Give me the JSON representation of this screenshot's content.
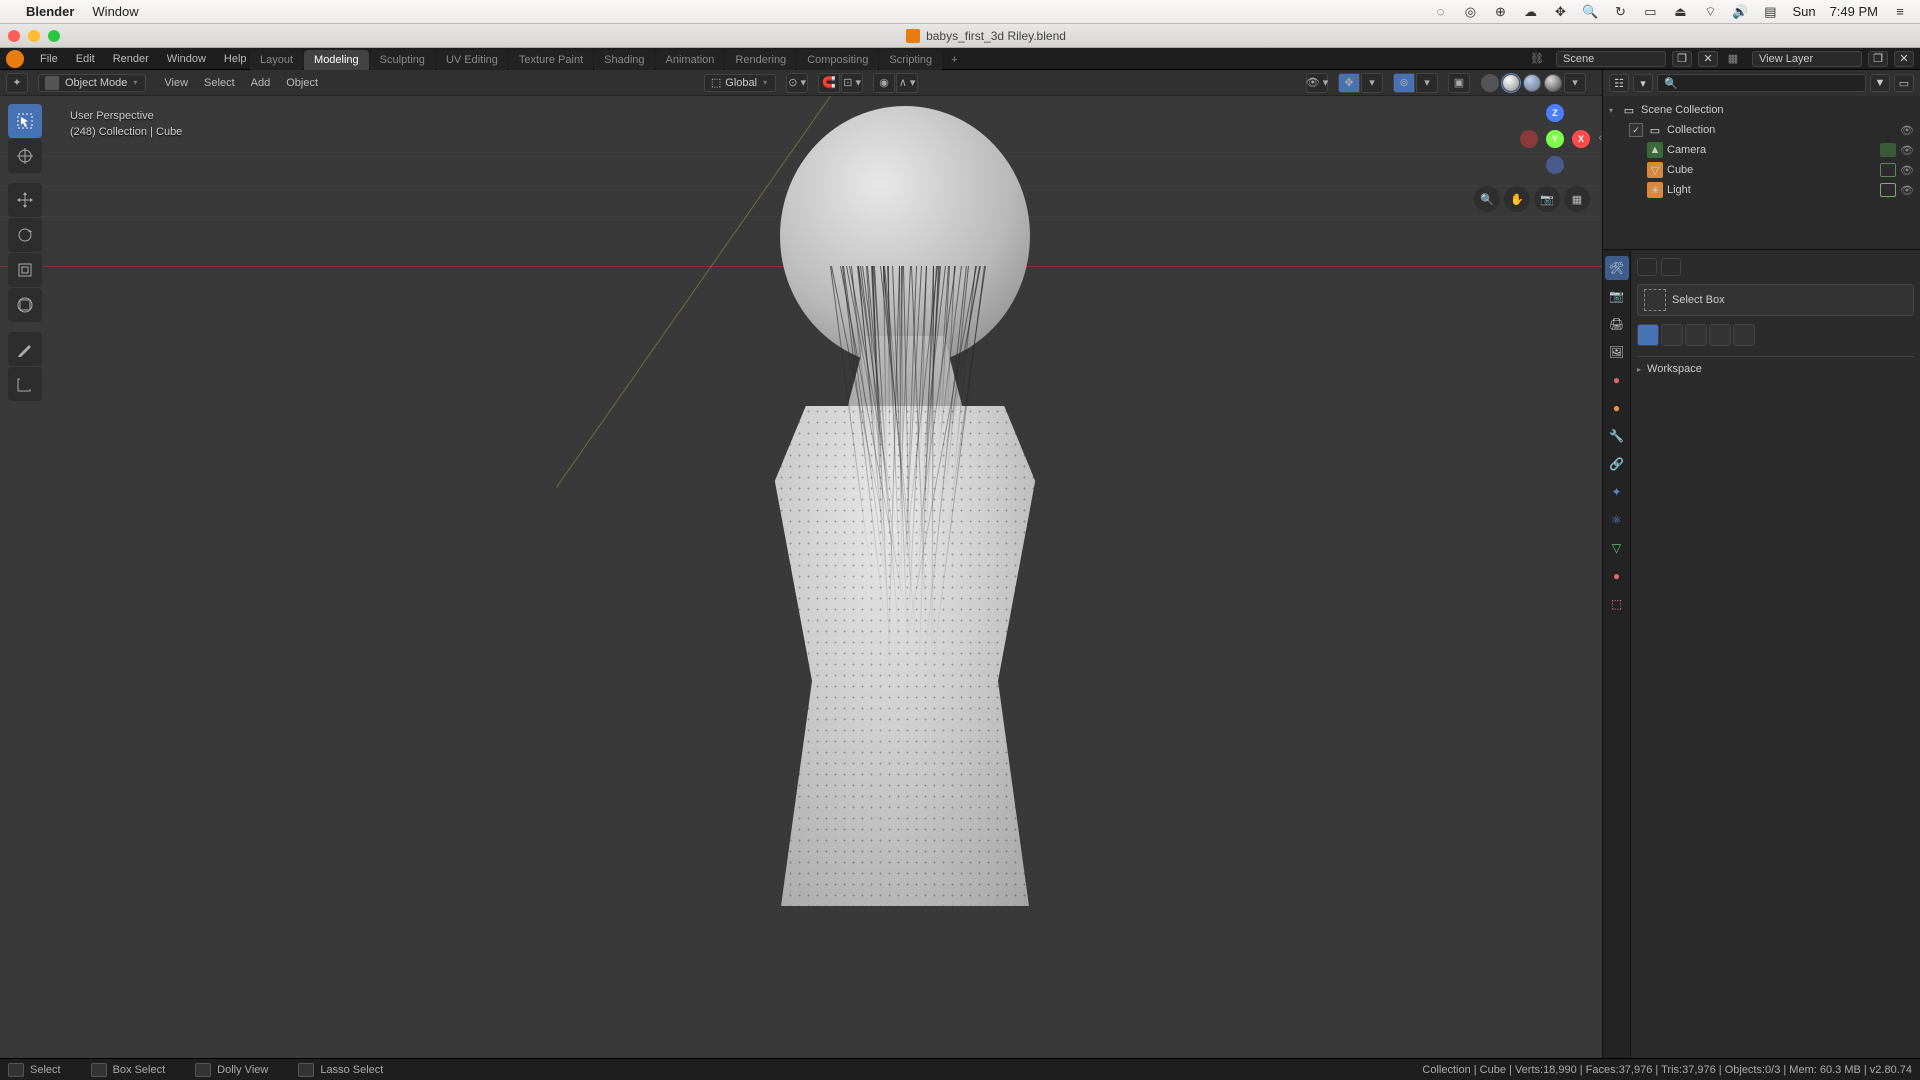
{
  "mac": {
    "app": "Blender",
    "menu2": "Window",
    "day": "Sun",
    "time": "7:49 PM"
  },
  "window": {
    "title": "babys_first_3d Riley.blend"
  },
  "topmenu": {
    "file": "File",
    "edit": "Edit",
    "render": "Render",
    "window": "Window",
    "help": "Help"
  },
  "wstabs": [
    "Layout",
    "Modeling",
    "Sculpting",
    "UV Editing",
    "Texture Paint",
    "Shading",
    "Animation",
    "Rendering",
    "Compositing",
    "Scripting"
  ],
  "wstab_active": 1,
  "scene_field": "Scene",
  "viewlayer_field": "View Layer",
  "vheader": {
    "mode": "Object Mode",
    "view": "View",
    "select": "Select",
    "add": "Add",
    "object": "Object",
    "orient": "Global"
  },
  "viewport_info": {
    "l1": "User Perspective",
    "l2": "(248) Collection | Cube"
  },
  "outliner": {
    "root": "Scene Collection",
    "collection": "Collection",
    "camera": "Camera",
    "cube": "Cube",
    "light": "Light"
  },
  "props": {
    "tool": "Select Box",
    "workspace": "Workspace"
  },
  "status": {
    "select": "Select",
    "boxselect": "Box Select",
    "dolly": "Dolly View",
    "lasso": "Lasso Select",
    "right": "Collection | Cube | Verts:18,990 | Faces:37,976 | Tris:37,976 | Objects:0/3 | Mem: 60.3 MB | v2.80.74"
  }
}
